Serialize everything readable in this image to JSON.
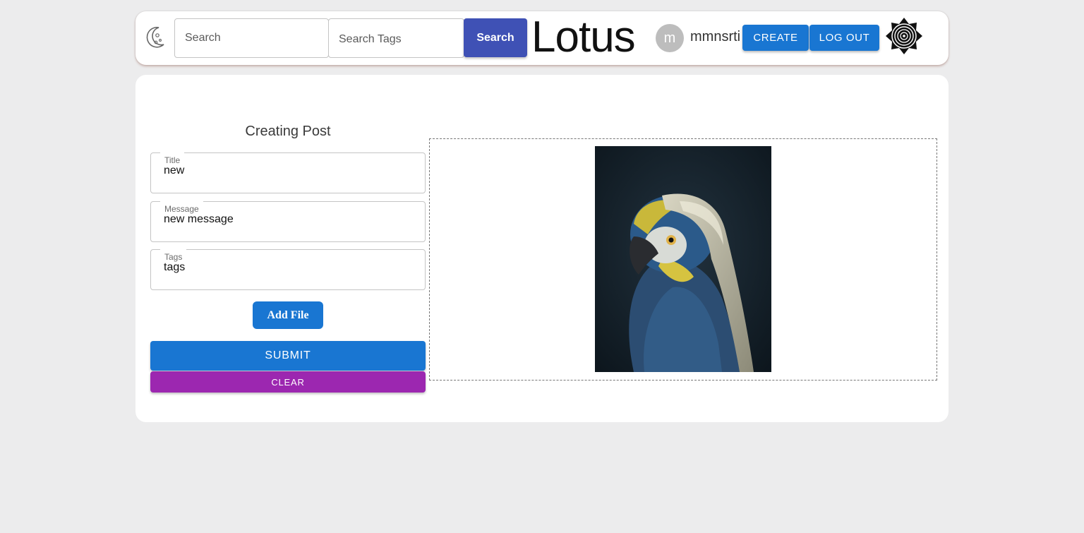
{
  "header": {
    "theme_toggle_icon": "moon-icon",
    "search_placeholder": "Search",
    "search_tags_placeholder": "Search Tags",
    "search_button_label": "Search",
    "brand": "Lotus",
    "avatar_initial": "m",
    "username": "mmnsrti",
    "create_label": "CREATE",
    "logout_label": "LOG OUT",
    "logo_icon": "lotus-logo-icon"
  },
  "form": {
    "heading": "Creating Post",
    "fields": [
      {
        "label": "Title",
        "value": "new"
      },
      {
        "label": "Message",
        "value": "new message"
      },
      {
        "label": "Tags",
        "value": "tags"
      }
    ],
    "add_file_label": "Add File",
    "submit_label": "SUBMIT",
    "clear_label": "CLEAR"
  },
  "preview": {
    "image_subject": "macaw-portrait-image"
  },
  "colors": {
    "primary": "#1976d2",
    "search_button": "#3f51b5",
    "clear": "#9c27b0",
    "background": "#ececed"
  }
}
